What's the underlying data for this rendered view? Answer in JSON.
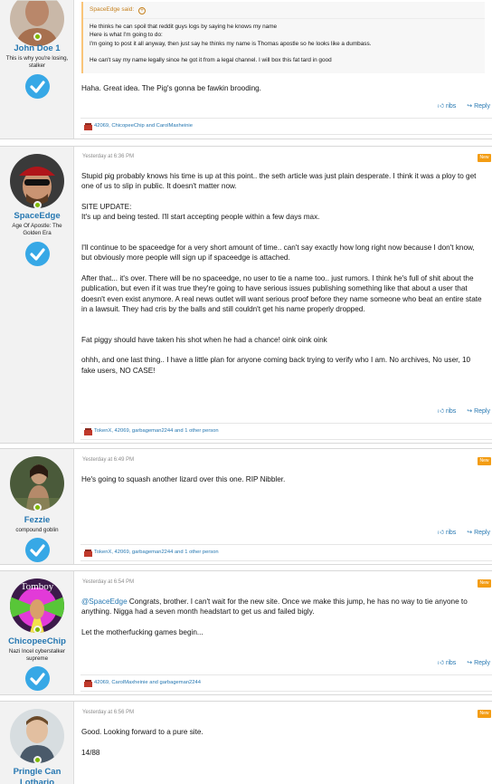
{
  "posts": [
    {
      "user": {
        "name": "John Doe 1",
        "title": "This is why you're losing, stalker"
      },
      "quote": {
        "author_line": "SpaceEdge said:",
        "lines": [
          "He thinks he can spoil that reddit guys logs by saying he knows my name",
          "Here is what I'm going to do:",
          "I'm going to post it all anyway, then just say he thinks my name is Thomas apostle so he looks like a dumbass.",
          "",
          "He can't say my name legally since he got it from a legal channel. I will box this fat tard in good"
        ]
      },
      "body": [
        "Haha. Great idea. The Pig's gonna be fawkin brooding."
      ],
      "actions": {
        "like": "ribs",
        "reply": "Reply"
      },
      "reactions": "42069, ChicopeeChip and CarolMaxheinie"
    },
    {
      "user": {
        "name": "SpaceEdge",
        "title": "Age Of Apostle: The Golden Era"
      },
      "timestamp": "Yesterday at 6:36 PM",
      "badge": "New",
      "body": [
        "Stupid pig probably knows his time is up at this point.. the seth article was just plain desperate. I think it was a ploy to get one of us to slip in public. It doesn't matter now.",
        "",
        "SITE UPDATE:",
        "It's up and being tested. I'll start accepting people within a few days max.",
        "",
        "",
        "I'll continue to be spaceedge for a very short amount of time.. can't say exactly how long right now because I don't know, but obviously more people will sign up if spaceedge is attached.",
        "",
        "After that... it's over. There will be no spaceedge, no user to tie a name too.. just rumors. I think he's full of shit about the publication, but even if it was true they're going to have serious issues publishing something like that about a user that doesn't even exist anymore. A real news outlet will want serious proof before they name someone who beat an entire state in a lawsuit. They had cris by the balls and still couldn't get his name properly dropped.",
        "",
        "",
        "Fat piggy should have taken his shot when he had a chance! oink oink oink",
        "",
        "ohhh, and one last thing.. I have a little plan for anyone coming back trying to verify who I am. No archives, No user, 10 fake users, NO CASE!"
      ],
      "actions": {
        "like": "ribs",
        "reply": "Reply"
      },
      "reactions": "TokenX, 42069, garbageman2244 and 1 other person"
    },
    {
      "user": {
        "name": "Fezzie",
        "title": "compound goblin"
      },
      "timestamp": "Yesterday at 6:49 PM",
      "badge": "New",
      "body": [
        "He's going to squash another lizard over this one. RIP Nibbler."
      ],
      "actions": {
        "like": "ribs",
        "reply": "Reply"
      },
      "reactions": "TokenX, 42069, garbageman2244 and 1 other person"
    },
    {
      "user": {
        "name": "ChicopeeChip",
        "title": "Nazi Incel cyberstalker supreme",
        "avatar_text": "Tomboy"
      },
      "timestamp": "Yesterday at 6:54 PM",
      "badge": "New",
      "mention": "@SpaceEdge",
      "body": [
        " Congrats, brother. I can't wait for the new site. Once we make this jump, he has no way to tie anyone to anything. Nigga had a seven month headstart to get us and failed bigly.",
        "",
        "Let the motherfucking games begin..."
      ],
      "actions": {
        "like": "ribs",
        "reply": "Reply"
      },
      "reactions": "42069, CarolMaxheinie and garbageman2244"
    },
    {
      "user": {
        "name": "Pringle Can Lothario",
        "title": ""
      },
      "timestamp": "Yesterday at 6:56 PM",
      "badge": "New",
      "body": [
        "Good. Looking forward to a pure site.",
        "",
        "14/88"
      ]
    }
  ],
  "colors": {
    "accent": "#2577b1",
    "badge": "#f39c12",
    "quote_border": "#f9c479",
    "quote_author": "#c6801d",
    "online": "#7fb900",
    "verified": "#37a8e6"
  },
  "icons": [
    "online-indicator-icon",
    "verified-badge-icon",
    "like-icon",
    "reply-icon",
    "reaction-icon",
    "quote-expand-icon"
  ]
}
